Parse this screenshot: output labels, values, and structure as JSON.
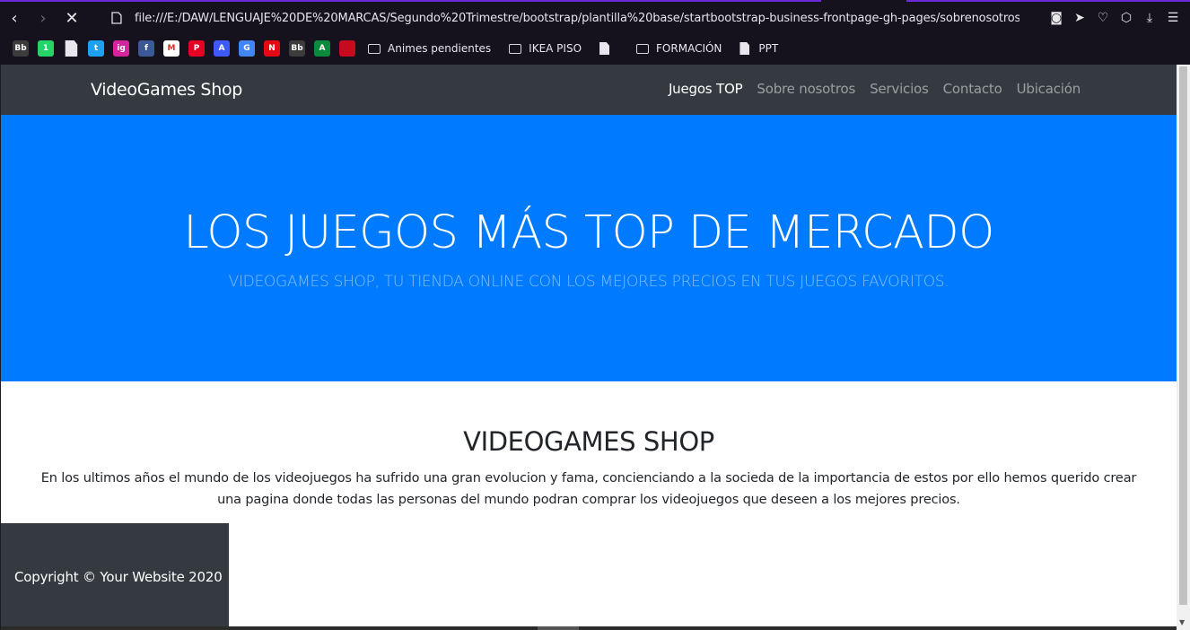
{
  "browser": {
    "url": "file:///E:/DAW/LENGUAJE%20DE%20MARCAS/Segundo%20Trimestre/bootstrap/plantilla%20base/startbootstrap-business-frontpage-gh-pages/sobrenosotros.",
    "bookmarks": [
      {
        "icon": "bb-icon",
        "text": "Bb",
        "color": "#3c3c3c"
      },
      {
        "icon": "whatsapp-icon",
        "text": "1",
        "color": "#25d366"
      },
      {
        "icon": "document-icon",
        "text": "",
        "color": "#e8e6ec"
      },
      {
        "icon": "twitter-icon",
        "text": "t",
        "color": "#1da1f2"
      },
      {
        "icon": "instagram-icon",
        "text": "ig",
        "color": "#d6249f"
      },
      {
        "icon": "facebook-icon",
        "text": "f",
        "color": "#3b5998"
      },
      {
        "icon": "gmail-icon",
        "text": "M",
        "color": "#ffffff"
      },
      {
        "icon": "pinterest-icon",
        "text": "P",
        "color": "#e60023"
      },
      {
        "icon": "figure-icon",
        "text": "A",
        "color": "#3d5afe"
      },
      {
        "icon": "translate-icon",
        "text": "G",
        "color": "#4285f4"
      },
      {
        "icon": "netflix-icon",
        "text": "N",
        "color": "#e50914"
      },
      {
        "icon": "bb-icon",
        "text": "Bb",
        "color": "#3c3c3c"
      },
      {
        "icon": "andalucia-icon",
        "text": "A",
        "color": "#0b8a3d"
      },
      {
        "icon": "spain-icon",
        "text": "",
        "color": "#c60b1e"
      }
    ],
    "folders": [
      {
        "type": "folder",
        "label": "Animes pendientes"
      },
      {
        "type": "folder",
        "label": "IKEA PISO"
      },
      {
        "type": "document",
        "label": ""
      },
      {
        "type": "folder",
        "label": "FORMACIÓN"
      },
      {
        "type": "document",
        "label": "PPT"
      }
    ]
  },
  "site": {
    "brand": "VideoGames Shop",
    "nav": [
      {
        "label": "Juegos TOP",
        "active": true
      },
      {
        "label": "Sobre nosotros",
        "active": false
      },
      {
        "label": "Servicios",
        "active": false
      },
      {
        "label": "Contacto",
        "active": false
      },
      {
        "label": "Ubicación",
        "active": false
      }
    ],
    "hero": {
      "title": "LOS JUEGOS MÁS TOP DE MERCADO",
      "subtitle": "VIDEOGAMES SHOP, TU TIENDA ONLINE CON LOS MEJORES PRECIOS EN TUS JUEGOS FAVORITOS."
    },
    "about": {
      "title": "VIDEOGAMES SHOP",
      "text": "En los ultimos años el mundo de los videojuegos ha sufrido una gran evolucion y fama, concienciando a la socieda de la importancia de estos por ello hemos querido crear una pagina donde todas las personas del mundo podran comprar los videojuegos que deseen a los mejores precios."
    },
    "footer": {
      "copyright": "Copyright © Your Website 2020"
    }
  },
  "colors": {
    "navbar": "#343a40",
    "hero": "#007bff",
    "accent": "#6b2bd8"
  }
}
